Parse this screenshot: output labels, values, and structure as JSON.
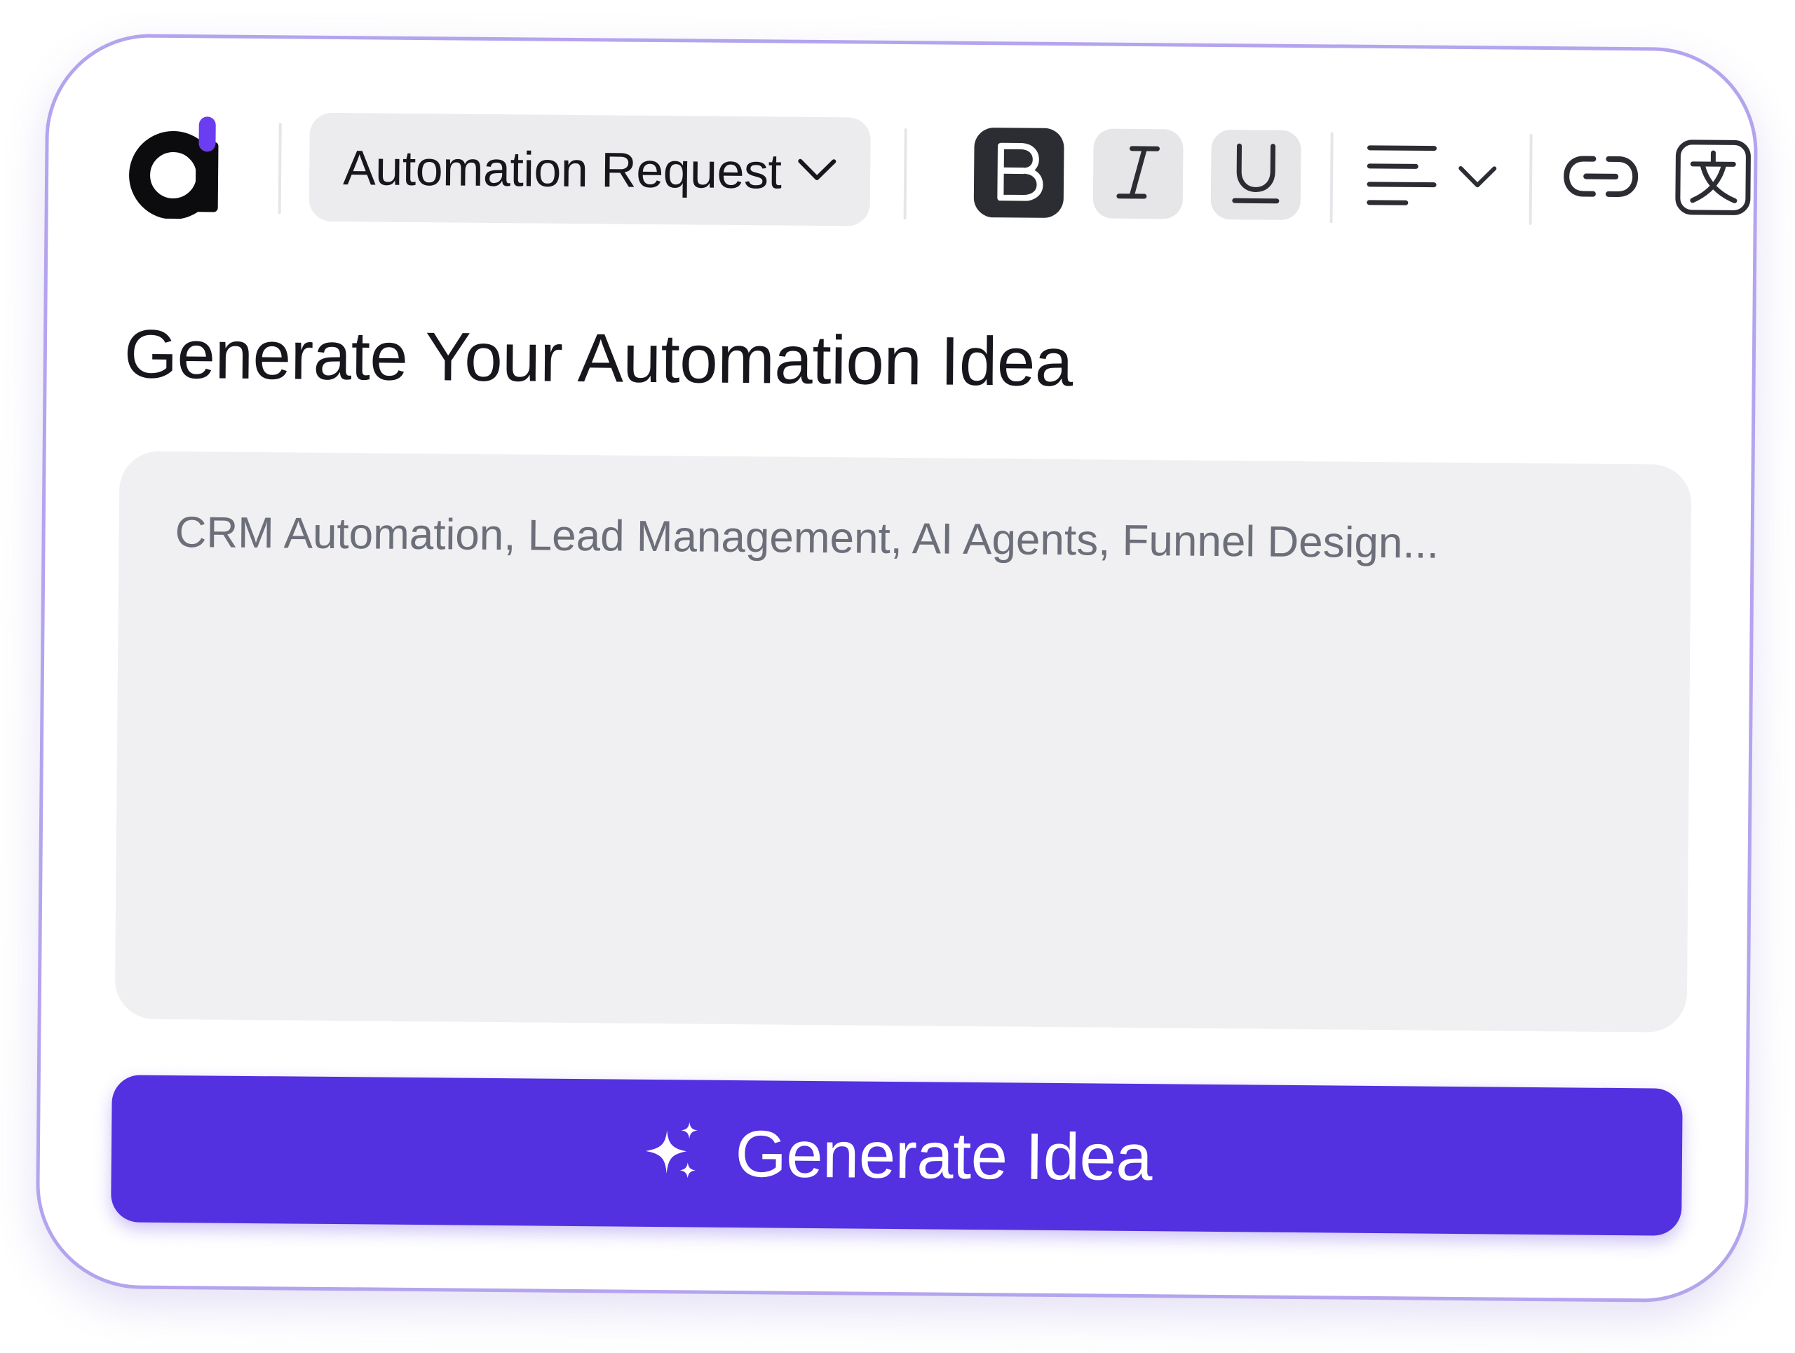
{
  "app": {
    "logo_icon": "app-logo-icon"
  },
  "toolbar": {
    "template_dropdown": {
      "label": "Automation Request",
      "icon": "chevron-down-icon"
    },
    "bold": {
      "icon": "bold-icon",
      "active": true
    },
    "italic": {
      "icon": "italic-icon",
      "active": false
    },
    "underline": {
      "icon": "underline-icon",
      "active": false
    },
    "align": {
      "icon": "align-left-icon",
      "dropdown_icon": "chevron-down-icon"
    },
    "link": {
      "icon": "link-icon"
    },
    "translate": {
      "icon": "translate-icon"
    }
  },
  "main": {
    "title": "Generate Your Automation Idea",
    "input": {
      "value": "",
      "placeholder": "CRM Automation, Lead Management, AI Agents, Funnel Design..."
    },
    "generate_button": {
      "label": "Generate Idea",
      "icon": "sparkle-icon"
    }
  },
  "colors": {
    "accent": "#5330e0",
    "card_border": "#b4a4ee",
    "input_bg": "#f0f0f2",
    "active_button_bg": "#2b2d33"
  }
}
